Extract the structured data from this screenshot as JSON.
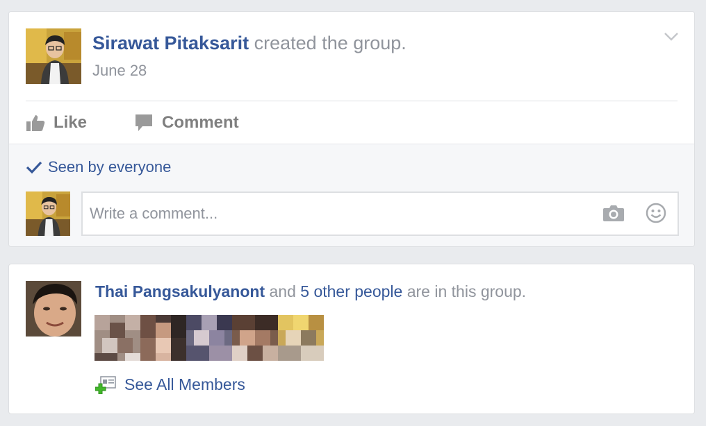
{
  "post": {
    "author_name": "Sirawat Pitaksarit",
    "action_text": "created the group.",
    "date": "June 28",
    "like_label": "Like",
    "comment_label": "Comment",
    "seen_text": "Seen by everyone",
    "comment_placeholder": "Write a comment..."
  },
  "members": {
    "member_name": "Thai Pangsakulyanont",
    "and_text": "and",
    "others_link": "5 other people",
    "suffix_text": "are in this group.",
    "see_all_label": "See All Members",
    "thumbnail_count": 5
  },
  "colors": {
    "link": "#365899",
    "muted": "#90949c",
    "background": "#e9ebee"
  },
  "icons": {
    "post_menu": "chevron-down-icon",
    "like": "thumbs-up-icon",
    "comment": "speech-bubble-icon",
    "seen": "checkmark-icon",
    "camera": "camera-icon",
    "emoji": "smiley-icon",
    "see_all": "add-member-icon"
  }
}
